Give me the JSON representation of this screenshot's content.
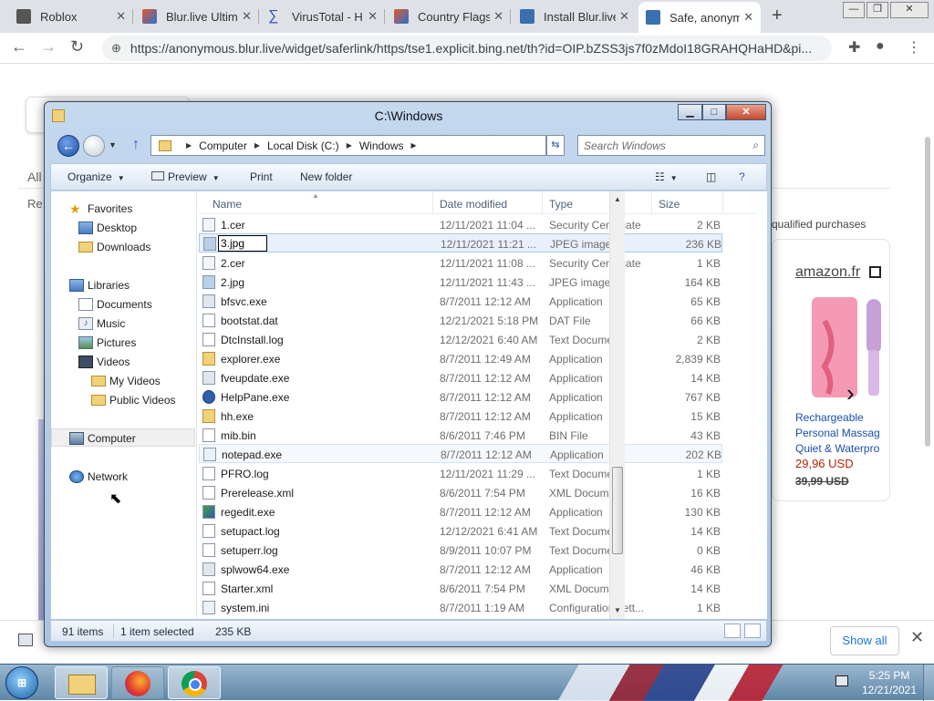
{
  "browser": {
    "tabs": [
      {
        "label": "Roblox",
        "color": "#555555"
      },
      {
        "label": "Blur.live Ultim",
        "color": "#e05a2a"
      },
      {
        "label": "VirusTotal - H",
        "color": "#3950c4"
      },
      {
        "label": "Country Flags",
        "color": "#e05a2a"
      },
      {
        "label": "Install Blur.live",
        "color": "#3a6fb0"
      },
      {
        "label": "Safe, anonym",
        "color": "#3a6fb0"
      }
    ],
    "new_tab": "+",
    "url": "https://anonymous.blur.live/widget/saferlink/https/tse1.explicit.bing.net/th?id=OIP.bZSS3js7f0zMdoI18GRAHQHaHD&pi...",
    "window_controls": {
      "minimize": "—",
      "maximize": "❐",
      "close": "✕"
    }
  },
  "background_page": {
    "all_label": "All",
    "re_label": "Re",
    "qualified": "qualified purchases",
    "card": {
      "store": "amazon.fr",
      "title": "Rechargeable Personal Massag Quiet & Waterpro",
      "price": "29,96 USD",
      "old_price": "39,99 USD"
    }
  },
  "download_bar": {
    "show_all": "Show all",
    "close": "✕"
  },
  "explorer": {
    "title": "C:\\Windows",
    "breadcrumb": [
      "Computer",
      "Local Disk (C:)",
      "Windows"
    ],
    "search_placeholder": "Search Windows",
    "commands": {
      "organize": "Organize",
      "preview": "Preview",
      "print": "Print",
      "new_folder": "New folder"
    },
    "nav": {
      "favorites": "Favorites",
      "desktop": "Desktop",
      "downloads": "Downloads",
      "libraries": "Libraries",
      "documents": "Documents",
      "music": "Music",
      "pictures": "Pictures",
      "videos": "Videos",
      "my_videos": "My Videos",
      "public_videos": "Public Videos",
      "computer": "Computer",
      "network": "Network"
    },
    "columns": {
      "name": "Name",
      "date": "Date modified",
      "type": "Type",
      "size": "Size"
    },
    "rename_value": "3.jpg",
    "files": [
      {
        "name": "1.cer",
        "date": "12/11/2021 11:04 ...",
        "type": "Security Certificate",
        "size": "2 KB",
        "icon": "certificate-icon"
      },
      {
        "name": "",
        "date": "12/11/2021 11:21 ...",
        "type": "JPEG image",
        "size": "236 KB",
        "icon": "image-icon"
      },
      {
        "name": "2.cer",
        "date": "12/11/2021 11:08 ...",
        "type": "Security Certificate",
        "size": "1 KB",
        "icon": "certificate-icon"
      },
      {
        "name": "2.jpg",
        "date": "12/11/2021 11:43 ...",
        "type": "JPEG image",
        "size": "164 KB",
        "icon": "image-icon"
      },
      {
        "name": "bfsvc.exe",
        "date": "8/7/2011 12:12 AM",
        "type": "Application",
        "size": "65 KB",
        "icon": "application-icon"
      },
      {
        "name": "bootstat.dat",
        "date": "12/21/2021 5:18 PM",
        "type": "DAT File",
        "size": "66 KB",
        "icon": "file-icon"
      },
      {
        "name": "DtcInstall.log",
        "date": "12/12/2021 6:40 AM",
        "type": "Text Document",
        "size": "2 KB",
        "icon": "text-file-icon"
      },
      {
        "name": "explorer.exe",
        "date": "8/7/2011 12:49 AM",
        "type": "Application",
        "size": "2,839 KB",
        "icon": "explorer-icon"
      },
      {
        "name": "fveupdate.exe",
        "date": "8/7/2011 12:12 AM",
        "type": "Application",
        "size": "14 KB",
        "icon": "application-icon"
      },
      {
        "name": "HelpPane.exe",
        "date": "8/7/2011 12:12 AM",
        "type": "Application",
        "size": "767 KB",
        "icon": "help-icon"
      },
      {
        "name": "hh.exe",
        "date": "8/7/2011 12:12 AM",
        "type": "Application",
        "size": "15 KB",
        "icon": "application-icon"
      },
      {
        "name": "mib.bin",
        "date": "8/6/2011 7:46 PM",
        "type": "BIN File",
        "size": "43 KB",
        "icon": "file-icon"
      },
      {
        "name": "notepad.exe",
        "date": "8/7/2011 12:12 AM",
        "type": "Application",
        "size": "202 KB",
        "icon": "notepad-icon"
      },
      {
        "name": "PFRO.log",
        "date": "12/11/2021 11:29 ...",
        "type": "Text Document",
        "size": "1 KB",
        "icon": "text-file-icon"
      },
      {
        "name": "Prerelease.xml",
        "date": "8/6/2011 7:54 PM",
        "type": "XML Document",
        "size": "16 KB",
        "icon": "xml-file-icon"
      },
      {
        "name": "regedit.exe",
        "date": "8/7/2011 12:12 AM",
        "type": "Application",
        "size": "130 KB",
        "icon": "regedit-icon"
      },
      {
        "name": "setupact.log",
        "date": "12/12/2021 6:41 AM",
        "type": "Text Document",
        "size": "14 KB",
        "icon": "text-file-icon"
      },
      {
        "name": "setuperr.log",
        "date": "8/9/2011 10:07 PM",
        "type": "Text Document",
        "size": "0 KB",
        "icon": "text-file-icon"
      },
      {
        "name": "splwow64.exe",
        "date": "8/7/2011 12:12 AM",
        "type": "Application",
        "size": "46 KB",
        "icon": "application-icon"
      },
      {
        "name": "Starter.xml",
        "date": "8/6/2011 7:54 PM",
        "type": "XML Document",
        "size": "14 KB",
        "icon": "xml-file-icon"
      },
      {
        "name": "system.ini",
        "date": "8/7/2011 1:19 AM",
        "type": "Configuration sett...",
        "size": "1 KB",
        "icon": "config-file-icon"
      }
    ],
    "status": {
      "count": "91 items",
      "selected": "1 item selected",
      "size": "235 KB"
    }
  },
  "taskbar": {
    "start": "⊞",
    "time": "5:25 PM",
    "date": "12/21/2021"
  }
}
